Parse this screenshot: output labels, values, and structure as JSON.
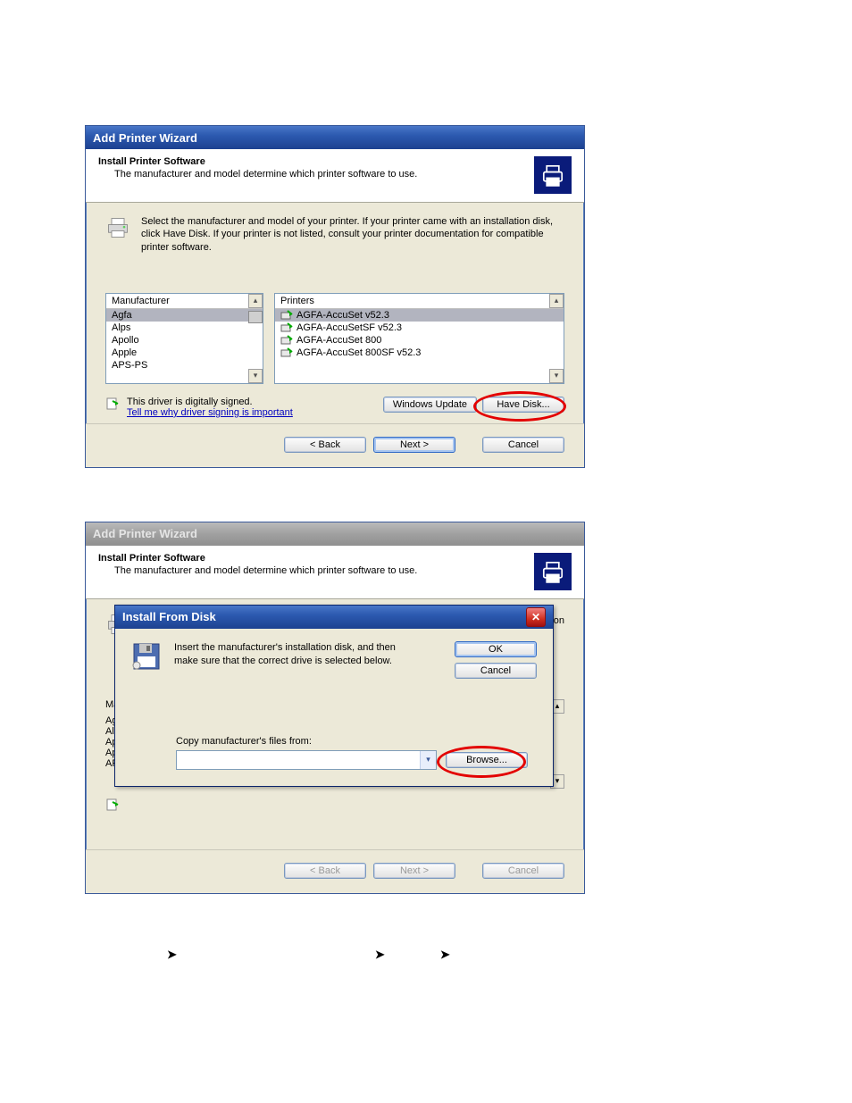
{
  "dialog1": {
    "title": "Add Printer Wizard",
    "banner_title": "Install Printer Software",
    "banner_subtitle": "The manufacturer and model determine which printer software to use.",
    "info_text": "Select the manufacturer and model of your printer. If your printer came with an installation disk, click Have Disk. If your printer is not listed, consult your printer documentation for compatible printer software.",
    "manufacturer_header": "Manufacturer",
    "printers_header": "Printers",
    "manufacturers": [
      "Agfa",
      "Alps",
      "Apollo",
      "Apple",
      "APS-PS"
    ],
    "printers": [
      "AGFA-AccuSet v52.3",
      "AGFA-AccuSetSF v52.3",
      "AGFA-AccuSet 800",
      "AGFA-AccuSet 800SF v52.3"
    ],
    "signed_text": "This driver is digitally signed.",
    "signed_link": "Tell me why driver signing is important",
    "btn_win_update": "Windows Update",
    "btn_have_disk": "Have Disk...",
    "btn_back": "< Back",
    "btn_next": "Next >",
    "btn_cancel": "Cancel"
  },
  "dialog2": {
    "title": "Add Printer Wizard",
    "banner_title": "Install Printer Software",
    "banner_subtitle": "The manufacturer and model determine which printer software to use.",
    "peek_manufacturers": [
      "Ma",
      "Agf",
      "Alp",
      "Apo",
      "App",
      "AP"
    ],
    "btn_back": "< Back",
    "btn_next": "Next >",
    "btn_cancel": "Cancel",
    "modal": {
      "title": "Install From Disk",
      "instr": "Insert the manufacturer's installation disk, and then make sure that the correct drive is selected below.",
      "copy_label": "Copy manufacturer's files from:",
      "btn_ok": "OK",
      "btn_cancel": "Cancel",
      "btn_browse": "Browse..."
    }
  }
}
